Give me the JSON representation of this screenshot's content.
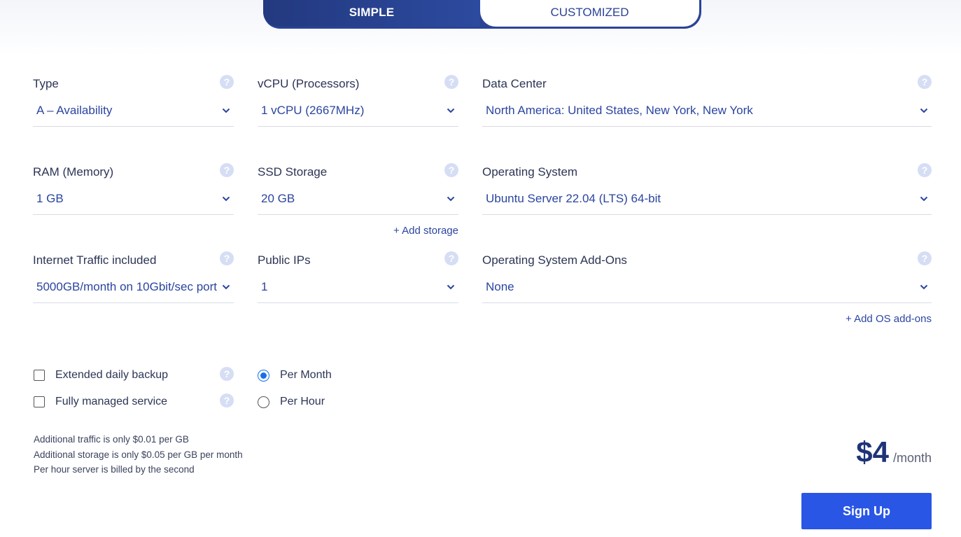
{
  "mode_toggle": {
    "simple_label": "SIMPLE",
    "customized_label": "CUSTOMIZED",
    "active": "simple"
  },
  "fields": {
    "type": {
      "label": "Type",
      "value": "A – Availability"
    },
    "vcpu": {
      "label": "vCPU (Processors)",
      "value": "1 vCPU (2667MHz)"
    },
    "data_center": {
      "label": "Data Center",
      "value": "North America: United States, New York, New York"
    },
    "ram": {
      "label": "RAM (Memory)",
      "value": "1 GB"
    },
    "ssd": {
      "label": "SSD Storage",
      "value": "20 GB"
    },
    "os": {
      "label": "Operating System",
      "value": "Ubuntu Server 22.04 (LTS) 64-bit"
    },
    "traffic": {
      "label": "Internet Traffic included",
      "value": "5000GB/month on 10Gbit/sec port"
    },
    "public_ips": {
      "label": "Public IPs",
      "value": "1"
    },
    "os_addons": {
      "label": "Operating System Add-Ons",
      "value": "None"
    }
  },
  "links": {
    "add_storage": "+ Add storage",
    "add_os_addons": "+ Add OS add-ons"
  },
  "options": {
    "extended_backup": {
      "label": "Extended daily backup",
      "checked": false
    },
    "managed_service": {
      "label": "Fully managed service",
      "checked": false
    }
  },
  "billing": {
    "per_month": {
      "label": "Per Month",
      "selected": true
    },
    "per_hour": {
      "label": "Per Hour",
      "selected": false
    }
  },
  "notes": {
    "line1": "Additional traffic is only $0.01 per GB",
    "line2": "Additional storage is only $0.05 per GB per month",
    "line3": "Per hour server is billed by the second"
  },
  "price": {
    "amount": "$4",
    "unit": "/month"
  },
  "signup_label": "Sign Up",
  "help_glyph": "?",
  "icons": {
    "help": "question-circle-icon",
    "dropdown": "chevron-down-icon"
  },
  "colors": {
    "primary": "#2b4397",
    "link": "#2b45a0",
    "button": "#2a56e6",
    "help": "#d6def5",
    "radio": "#1a6fe8"
  }
}
